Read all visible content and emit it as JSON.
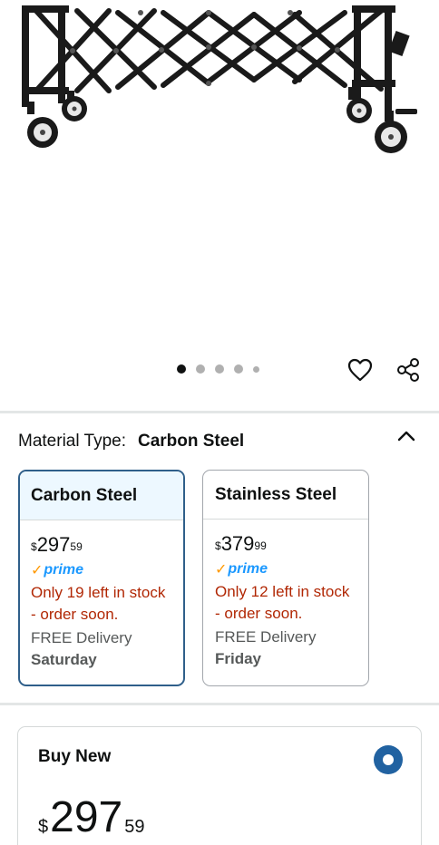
{
  "gallery": {
    "dot_count": 5,
    "active_index": 0
  },
  "material": {
    "label": "Material Type:",
    "selected_value": "Carbon Steel"
  },
  "variants": [
    {
      "name": "Carbon Steel",
      "price_symbol": "$",
      "price_whole": "297",
      "price_fraction": "59",
      "prime_label": "prime",
      "stock": "Only 19 left in stock - order soon.",
      "delivery_label": "FREE Delivery",
      "delivery_day": "Saturday",
      "selected": true
    },
    {
      "name": "Stainless Steel",
      "price_symbol": "$",
      "price_whole": "379",
      "price_fraction": "99",
      "prime_label": "prime",
      "stock": "Only 12 left in stock - order soon.",
      "delivery_label": "FREE Delivery",
      "delivery_day": "Friday",
      "selected": false
    }
  ],
  "buy_new": {
    "title": "Buy New",
    "price_symbol": "$",
    "price_whole": "297",
    "price_fraction": "59",
    "selected": true
  },
  "colors": {
    "selected_border": "#2f5f8a",
    "selected_header_bg": "#edf8ff",
    "stock_red": "#b12704",
    "prime_blue": "#1a98ff",
    "prime_check": "#ff9900",
    "radio_blue": "#2162a1"
  },
  "icons": [
    "heart-icon",
    "share-icon",
    "chevron-up-icon",
    "prime-check-icon"
  ]
}
